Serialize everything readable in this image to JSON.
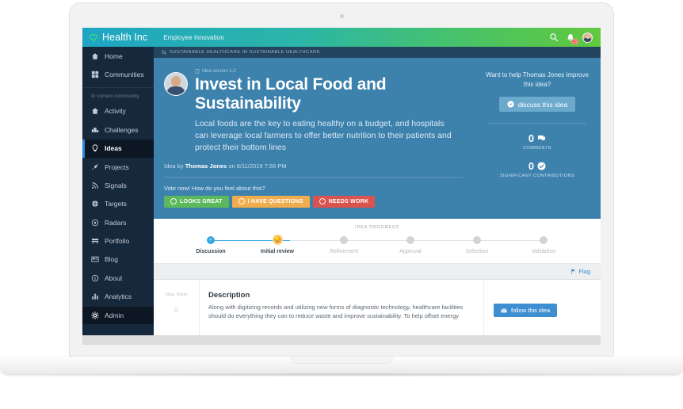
{
  "header": {
    "brand_name": "Health Inc",
    "brand_sub": "Employee Innovation",
    "search_icon": "search-icon",
    "bell_icon": "bell-icon",
    "notification_count": "23",
    "avatar_icon": "user-avatar"
  },
  "sidebar": {
    "section_label": "In current community",
    "items": [
      {
        "label": "Home",
        "icon": "home-icon"
      },
      {
        "label": "Communities",
        "icon": "grid-icon"
      },
      {
        "label": "Activity",
        "icon": "home-icon"
      },
      {
        "label": "Challenges",
        "icon": "challenges-icon"
      },
      {
        "label": "Ideas",
        "icon": "lightbulb-icon"
      },
      {
        "label": "Projects",
        "icon": "rocket-icon"
      },
      {
        "label": "Signals",
        "icon": "signal-icon"
      },
      {
        "label": "Targets",
        "icon": "target-icon"
      },
      {
        "label": "Radars",
        "icon": "radar-icon"
      },
      {
        "label": "Portfolio",
        "icon": "portfolio-icon"
      },
      {
        "label": "Blog",
        "icon": "blog-icon"
      },
      {
        "label": "About",
        "icon": "info-icon"
      },
      {
        "label": "Analytics",
        "icon": "analytics-icon"
      }
    ],
    "admin": {
      "label": "Admin",
      "icon": "gear-icon"
    }
  },
  "breadcrumb": {
    "text": "SUSTAINABLE HEALTHCARE in SUSTAINABLE HEALTHCARE",
    "icon": "challenge-icon"
  },
  "hero": {
    "version_tag": "Idea version 1.2",
    "version_icon": "document-icon",
    "title": "Invest in Local Food and Sustainability",
    "description": "Local foods are the key to eating healthy on a budget, and hospitals can leverage local farmers to offer better nutrition to their patients and protect their bottom lines",
    "byline_prefix": "Idea by",
    "author": "Thomas Jones",
    "byline_middle": "on",
    "date": "6/11/2019 7:56 PM",
    "vote_prompt": "Vote now! How do you feel about this?",
    "vote_buttons": [
      {
        "label": "LOOKS GREAT",
        "icon": "smile-icon",
        "color": "#5cb85c"
      },
      {
        "label": "I HAVE QUESTIONS",
        "icon": "neutral-face-icon",
        "color": "#f0ad4e"
      },
      {
        "label": "NEEDS WORK",
        "icon": "frown-icon",
        "color": "#d9534f"
      }
    ]
  },
  "help_panel": {
    "prompt": "Want to help Thomas Jones improve this idea?",
    "discuss_label": "discuss this idea",
    "discuss_icon": "chevron-down-circle-icon",
    "stats": [
      {
        "value": "0",
        "label": "COMMENTS",
        "icon": "comment-icon"
      },
      {
        "value": "0",
        "label": "SIGNIFICANT CONTRIBUTIONS",
        "icon": "check-circle-icon"
      }
    ]
  },
  "progress": {
    "title": "IDEA PROGRESS",
    "steps": [
      {
        "label": "Discussion",
        "state": "done"
      },
      {
        "label": "Initial review",
        "state": "current"
      },
      {
        "label": "Refinement",
        "state": "pending"
      },
      {
        "label": "Approval",
        "state": "pending"
      },
      {
        "label": "Selection",
        "state": "pending"
      },
      {
        "label": "Validation",
        "state": "pending"
      }
    ]
  },
  "flag": {
    "label": "Flag",
    "icon": "flag-icon"
  },
  "description": {
    "rail_label": "Idea Stats",
    "rail_value": "0",
    "heading": "Description",
    "body": "Along with digitizing records and utilizing new forms of diagnostic technology, healthcare facilities should do everything they can to reduce waste and improve sustainability. To help offset energy",
    "follow_label": "follow this idea",
    "follow_icon": "envelope-icon"
  }
}
